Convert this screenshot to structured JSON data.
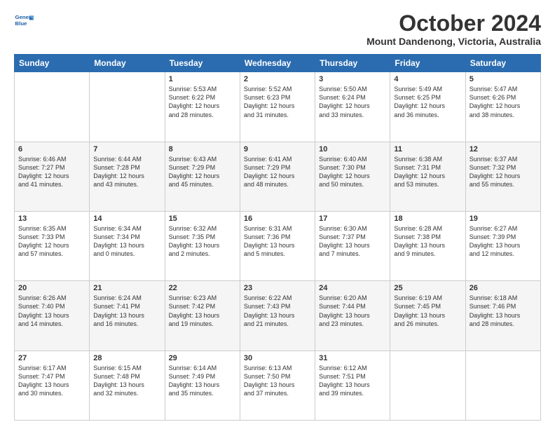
{
  "header": {
    "logo_line1": "General",
    "logo_line2": "Blue",
    "month": "October 2024",
    "location": "Mount Dandenong, Victoria, Australia"
  },
  "weekdays": [
    "Sunday",
    "Monday",
    "Tuesday",
    "Wednesday",
    "Thursday",
    "Friday",
    "Saturday"
  ],
  "weeks": [
    [
      {
        "day": "",
        "info": ""
      },
      {
        "day": "",
        "info": ""
      },
      {
        "day": "1",
        "info": "Sunrise: 5:53 AM\nSunset: 6:22 PM\nDaylight: 12 hours\nand 28 minutes."
      },
      {
        "day": "2",
        "info": "Sunrise: 5:52 AM\nSunset: 6:23 PM\nDaylight: 12 hours\nand 31 minutes."
      },
      {
        "day": "3",
        "info": "Sunrise: 5:50 AM\nSunset: 6:24 PM\nDaylight: 12 hours\nand 33 minutes."
      },
      {
        "day": "4",
        "info": "Sunrise: 5:49 AM\nSunset: 6:25 PM\nDaylight: 12 hours\nand 36 minutes."
      },
      {
        "day": "5",
        "info": "Sunrise: 5:47 AM\nSunset: 6:26 PM\nDaylight: 12 hours\nand 38 minutes."
      }
    ],
    [
      {
        "day": "6",
        "info": "Sunrise: 6:46 AM\nSunset: 7:27 PM\nDaylight: 12 hours\nand 41 minutes."
      },
      {
        "day": "7",
        "info": "Sunrise: 6:44 AM\nSunset: 7:28 PM\nDaylight: 12 hours\nand 43 minutes."
      },
      {
        "day": "8",
        "info": "Sunrise: 6:43 AM\nSunset: 7:29 PM\nDaylight: 12 hours\nand 45 minutes."
      },
      {
        "day": "9",
        "info": "Sunrise: 6:41 AM\nSunset: 7:29 PM\nDaylight: 12 hours\nand 48 minutes."
      },
      {
        "day": "10",
        "info": "Sunrise: 6:40 AM\nSunset: 7:30 PM\nDaylight: 12 hours\nand 50 minutes."
      },
      {
        "day": "11",
        "info": "Sunrise: 6:38 AM\nSunset: 7:31 PM\nDaylight: 12 hours\nand 53 minutes."
      },
      {
        "day": "12",
        "info": "Sunrise: 6:37 AM\nSunset: 7:32 PM\nDaylight: 12 hours\nand 55 minutes."
      }
    ],
    [
      {
        "day": "13",
        "info": "Sunrise: 6:35 AM\nSunset: 7:33 PM\nDaylight: 12 hours\nand 57 minutes."
      },
      {
        "day": "14",
        "info": "Sunrise: 6:34 AM\nSunset: 7:34 PM\nDaylight: 13 hours\nand 0 minutes."
      },
      {
        "day": "15",
        "info": "Sunrise: 6:32 AM\nSunset: 7:35 PM\nDaylight: 13 hours\nand 2 minutes."
      },
      {
        "day": "16",
        "info": "Sunrise: 6:31 AM\nSunset: 7:36 PM\nDaylight: 13 hours\nand 5 minutes."
      },
      {
        "day": "17",
        "info": "Sunrise: 6:30 AM\nSunset: 7:37 PM\nDaylight: 13 hours\nand 7 minutes."
      },
      {
        "day": "18",
        "info": "Sunrise: 6:28 AM\nSunset: 7:38 PM\nDaylight: 13 hours\nand 9 minutes."
      },
      {
        "day": "19",
        "info": "Sunrise: 6:27 AM\nSunset: 7:39 PM\nDaylight: 13 hours\nand 12 minutes."
      }
    ],
    [
      {
        "day": "20",
        "info": "Sunrise: 6:26 AM\nSunset: 7:40 PM\nDaylight: 13 hours\nand 14 minutes."
      },
      {
        "day": "21",
        "info": "Sunrise: 6:24 AM\nSunset: 7:41 PM\nDaylight: 13 hours\nand 16 minutes."
      },
      {
        "day": "22",
        "info": "Sunrise: 6:23 AM\nSunset: 7:42 PM\nDaylight: 13 hours\nand 19 minutes."
      },
      {
        "day": "23",
        "info": "Sunrise: 6:22 AM\nSunset: 7:43 PM\nDaylight: 13 hours\nand 21 minutes."
      },
      {
        "day": "24",
        "info": "Sunrise: 6:20 AM\nSunset: 7:44 PM\nDaylight: 13 hours\nand 23 minutes."
      },
      {
        "day": "25",
        "info": "Sunrise: 6:19 AM\nSunset: 7:45 PM\nDaylight: 13 hours\nand 26 minutes."
      },
      {
        "day": "26",
        "info": "Sunrise: 6:18 AM\nSunset: 7:46 PM\nDaylight: 13 hours\nand 28 minutes."
      }
    ],
    [
      {
        "day": "27",
        "info": "Sunrise: 6:17 AM\nSunset: 7:47 PM\nDaylight: 13 hours\nand 30 minutes."
      },
      {
        "day": "28",
        "info": "Sunrise: 6:15 AM\nSunset: 7:48 PM\nDaylight: 13 hours\nand 32 minutes."
      },
      {
        "day": "29",
        "info": "Sunrise: 6:14 AM\nSunset: 7:49 PM\nDaylight: 13 hours\nand 35 minutes."
      },
      {
        "day": "30",
        "info": "Sunrise: 6:13 AM\nSunset: 7:50 PM\nDaylight: 13 hours\nand 37 minutes."
      },
      {
        "day": "31",
        "info": "Sunrise: 6:12 AM\nSunset: 7:51 PM\nDaylight: 13 hours\nand 39 minutes."
      },
      {
        "day": "",
        "info": ""
      },
      {
        "day": "",
        "info": ""
      }
    ]
  ]
}
